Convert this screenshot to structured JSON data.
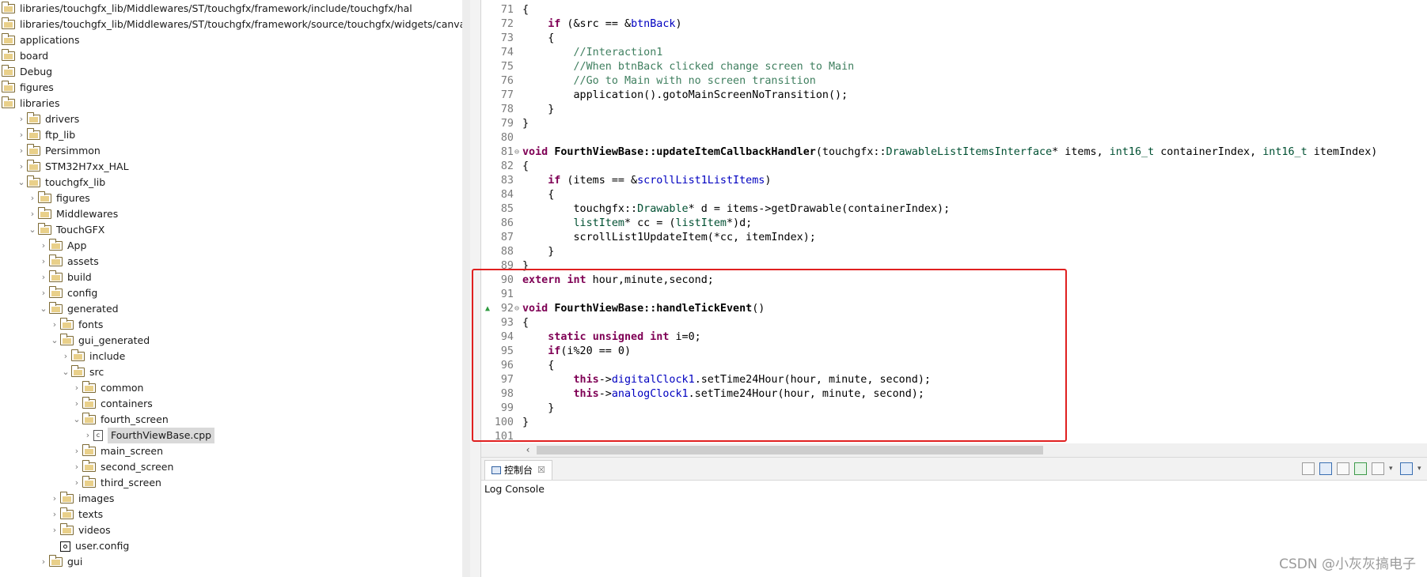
{
  "tree": [
    {
      "label": "libraries/touchgfx_lib/Middlewares/ST/touchgfx/framework/include/touchgfx/hal",
      "depth": 0,
      "twisty": ""
    },
    {
      "label": "libraries/touchgfx_lib/Middlewares/ST/touchgfx/framework/source/touchgfx/widgets/canvas",
      "depth": 0,
      "twisty": ""
    },
    {
      "label": "applications",
      "depth": 0,
      "twisty": ""
    },
    {
      "label": "board",
      "depth": 0,
      "twisty": ""
    },
    {
      "label": "Debug",
      "depth": 0,
      "twisty": ""
    },
    {
      "label": "figures",
      "depth": 0,
      "twisty": ""
    },
    {
      "label": "libraries",
      "depth": 0,
      "twisty": ""
    },
    {
      "label": "drivers",
      "depth": 1,
      "twisty": "›"
    },
    {
      "label": "ftp_lib",
      "depth": 1,
      "twisty": "›"
    },
    {
      "label": "Persimmon",
      "depth": 1,
      "twisty": "›"
    },
    {
      "label": "STM32H7xx_HAL",
      "depth": 1,
      "twisty": "›"
    },
    {
      "label": "touchgfx_lib",
      "depth": 1,
      "twisty": "⌄"
    },
    {
      "label": "figures",
      "depth": 2,
      "twisty": "›"
    },
    {
      "label": "Middlewares",
      "depth": 2,
      "twisty": "›"
    },
    {
      "label": "TouchGFX",
      "depth": 2,
      "twisty": "⌄"
    },
    {
      "label": "App",
      "depth": 3,
      "twisty": "›"
    },
    {
      "label": "assets",
      "depth": 3,
      "twisty": "›"
    },
    {
      "label": "build",
      "depth": 3,
      "twisty": "›"
    },
    {
      "label": "config",
      "depth": 3,
      "twisty": "›"
    },
    {
      "label": "generated",
      "depth": 3,
      "twisty": "⌄"
    },
    {
      "label": "fonts",
      "depth": 4,
      "twisty": "›"
    },
    {
      "label": "gui_generated",
      "depth": 4,
      "twisty": "⌄"
    },
    {
      "label": "include",
      "depth": 5,
      "twisty": "›"
    },
    {
      "label": "src",
      "depth": 5,
      "twisty": "⌄"
    },
    {
      "label": "common",
      "depth": 6,
      "twisty": "›"
    },
    {
      "label": "containers",
      "depth": 6,
      "twisty": "›"
    },
    {
      "label": "fourth_screen",
      "depth": 6,
      "twisty": "⌄"
    },
    {
      "label": "FourthViewBase.cpp",
      "depth": 7,
      "twisty": "›",
      "icon": "file",
      "selected": true
    },
    {
      "label": "main_screen",
      "depth": 6,
      "twisty": "›"
    },
    {
      "label": "second_screen",
      "depth": 6,
      "twisty": "›"
    },
    {
      "label": "third_screen",
      "depth": 6,
      "twisty": "›"
    },
    {
      "label": "images",
      "depth": 4,
      "twisty": "›"
    },
    {
      "label": "texts",
      "depth": 4,
      "twisty": "›"
    },
    {
      "label": "videos",
      "depth": 4,
      "twisty": "›"
    },
    {
      "label": "user.config",
      "depth": 4,
      "twisty": "",
      "icon": "config"
    },
    {
      "label": "gui",
      "depth": 3,
      "twisty": "›"
    }
  ],
  "code": [
    {
      "n": "71",
      "tokens": [
        [
          "{",
          ""
        ]
      ]
    },
    {
      "n": "72",
      "tokens": [
        [
          "    ",
          ""
        ],
        [
          "if",
          "kw"
        ],
        [
          " (&src == &",
          ""
        ],
        [
          "btnBack",
          "fd"
        ],
        [
          ")",
          ""
        ]
      ]
    },
    {
      "n": "73",
      "tokens": [
        [
          "    {",
          ""
        ]
      ]
    },
    {
      "n": "74",
      "tokens": [
        [
          "        //Interaction1",
          "cm"
        ]
      ]
    },
    {
      "n": "75",
      "tokens": [
        [
          "        //When btnBack clicked change screen to Main",
          "cm"
        ]
      ]
    },
    {
      "n": "76",
      "tokens": [
        [
          "        //Go to Main with no screen transition",
          "cm"
        ]
      ]
    },
    {
      "n": "77",
      "tokens": [
        [
          "        application().gotoMainScreenNoTransition();",
          ""
        ]
      ]
    },
    {
      "n": "78",
      "tokens": [
        [
          "    }",
          ""
        ]
      ]
    },
    {
      "n": "79",
      "tokens": [
        [
          "}",
          ""
        ]
      ]
    },
    {
      "n": "80",
      "tokens": []
    },
    {
      "n": "81",
      "fold": true,
      "tokens": [
        [
          "void",
          "kw"
        ],
        [
          " ",
          ""
        ],
        [
          "FourthViewBase::updateItemCallbackHandler",
          "fnb"
        ],
        [
          "(touchgfx::",
          ""
        ],
        [
          "DrawableListItemsInterface",
          "ty"
        ],
        [
          "* items, ",
          ""
        ],
        [
          "int16_t",
          "ty"
        ],
        [
          " containerIndex, ",
          ""
        ],
        [
          "int16_t",
          "ty"
        ],
        [
          " itemIndex)",
          ""
        ]
      ]
    },
    {
      "n": "82",
      "tokens": [
        [
          "{",
          ""
        ]
      ]
    },
    {
      "n": "83",
      "tokens": [
        [
          "    ",
          ""
        ],
        [
          "if",
          "kw"
        ],
        [
          " (items == &",
          ""
        ],
        [
          "scrollList1ListItems",
          "fd"
        ],
        [
          ")",
          ""
        ]
      ]
    },
    {
      "n": "84",
      "tokens": [
        [
          "    {",
          ""
        ]
      ]
    },
    {
      "n": "85",
      "tokens": [
        [
          "        touchgfx::",
          ""
        ],
        [
          "Drawable",
          "ty"
        ],
        [
          "* d = items->getDrawable(containerIndex);",
          ""
        ]
      ]
    },
    {
      "n": "86",
      "tokens": [
        [
          "        ",
          ""
        ],
        [
          "listItem",
          "ty"
        ],
        [
          "* cc = (",
          ""
        ],
        [
          "listItem",
          "ty"
        ],
        [
          "*)d;",
          ""
        ]
      ]
    },
    {
      "n": "87",
      "tokens": [
        [
          "        scrollList1UpdateItem(*cc, itemIndex);",
          ""
        ]
      ]
    },
    {
      "n": "88",
      "tokens": [
        [
          "    }",
          ""
        ]
      ]
    },
    {
      "n": "89",
      "tokens": [
        [
          "}",
          ""
        ]
      ]
    },
    {
      "n": "90",
      "tokens": [
        [
          "extern",
          "kw"
        ],
        [
          " ",
          ""
        ],
        [
          "int",
          "kw"
        ],
        [
          " hour,minute,second;",
          ""
        ]
      ]
    },
    {
      "n": "91",
      "tokens": []
    },
    {
      "n": "92",
      "fold": true,
      "marker": true,
      "tokens": [
        [
          "void",
          "kw"
        ],
        [
          " ",
          ""
        ],
        [
          "FourthViewBase::handleTickEvent",
          "fnb"
        ],
        [
          "()",
          ""
        ]
      ]
    },
    {
      "n": "93",
      "tokens": [
        [
          "{",
          ""
        ]
      ]
    },
    {
      "n": "94",
      "tokens": [
        [
          "    ",
          ""
        ],
        [
          "static",
          "kw"
        ],
        [
          " ",
          ""
        ],
        [
          "unsigned",
          "kw"
        ],
        [
          " ",
          ""
        ],
        [
          "int",
          "kw"
        ],
        [
          " i=0;",
          ""
        ]
      ]
    },
    {
      "n": "95",
      "tokens": [
        [
          "    ",
          ""
        ],
        [
          "if",
          "kw"
        ],
        [
          "(i%20 == 0)",
          ""
        ]
      ]
    },
    {
      "n": "96",
      "tokens": [
        [
          "    {",
          ""
        ]
      ]
    },
    {
      "n": "97",
      "tokens": [
        [
          "        ",
          ""
        ],
        [
          "this",
          "kw"
        ],
        [
          "->",
          ""
        ],
        [
          "digitalClock1",
          "fd"
        ],
        [
          ".setTime24Hour(hour, minute, second);",
          ""
        ]
      ]
    },
    {
      "n": "98",
      "tokens": [
        [
          "        ",
          ""
        ],
        [
          "this",
          "kw"
        ],
        [
          "->",
          ""
        ],
        [
          "analogClock1",
          "fd"
        ],
        [
          ".setTime24Hour(hour, minute, second);",
          ""
        ]
      ]
    },
    {
      "n": "99",
      "tokens": [
        [
          "    }",
          ""
        ]
      ]
    },
    {
      "n": "100",
      "tokens": [
        [
          "}",
          ""
        ]
      ]
    },
    {
      "n": "101",
      "tokens": []
    }
  ],
  "console": {
    "tab_label": "控制台",
    "close_glyph": "☒",
    "header": "Log Console"
  },
  "hscroll_left_glyph": "‹",
  "watermark": "CSDN @小灰灰搞电子",
  "colors": {
    "highlight": "#e02020",
    "keyword": "#7f0055",
    "comment": "#3f7f5f",
    "field": "#0000c0",
    "type": "#005032"
  }
}
